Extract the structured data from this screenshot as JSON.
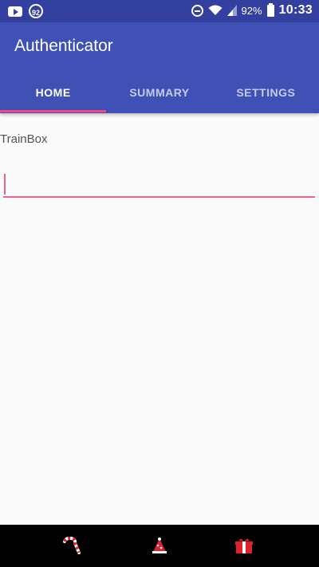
{
  "status_bar": {
    "notification_badge": "92",
    "battery": "92%",
    "time": "10:33"
  },
  "app": {
    "title": "Authenticator"
  },
  "tabs": [
    {
      "label": "HOME"
    },
    {
      "label": "SUMMARY"
    },
    {
      "label": "SETTINGS"
    }
  ],
  "form": {
    "label": "TrainBox",
    "input_value": ""
  },
  "colors": {
    "primary": "#3f51b5",
    "status_bar": "#3340a0",
    "accent": "#ff4081",
    "input_underline": "#f06292"
  },
  "nav": [
    {
      "icon": "candy-cane-icon"
    },
    {
      "icon": "party-hat-icon"
    },
    {
      "icon": "gift-icon"
    }
  ]
}
